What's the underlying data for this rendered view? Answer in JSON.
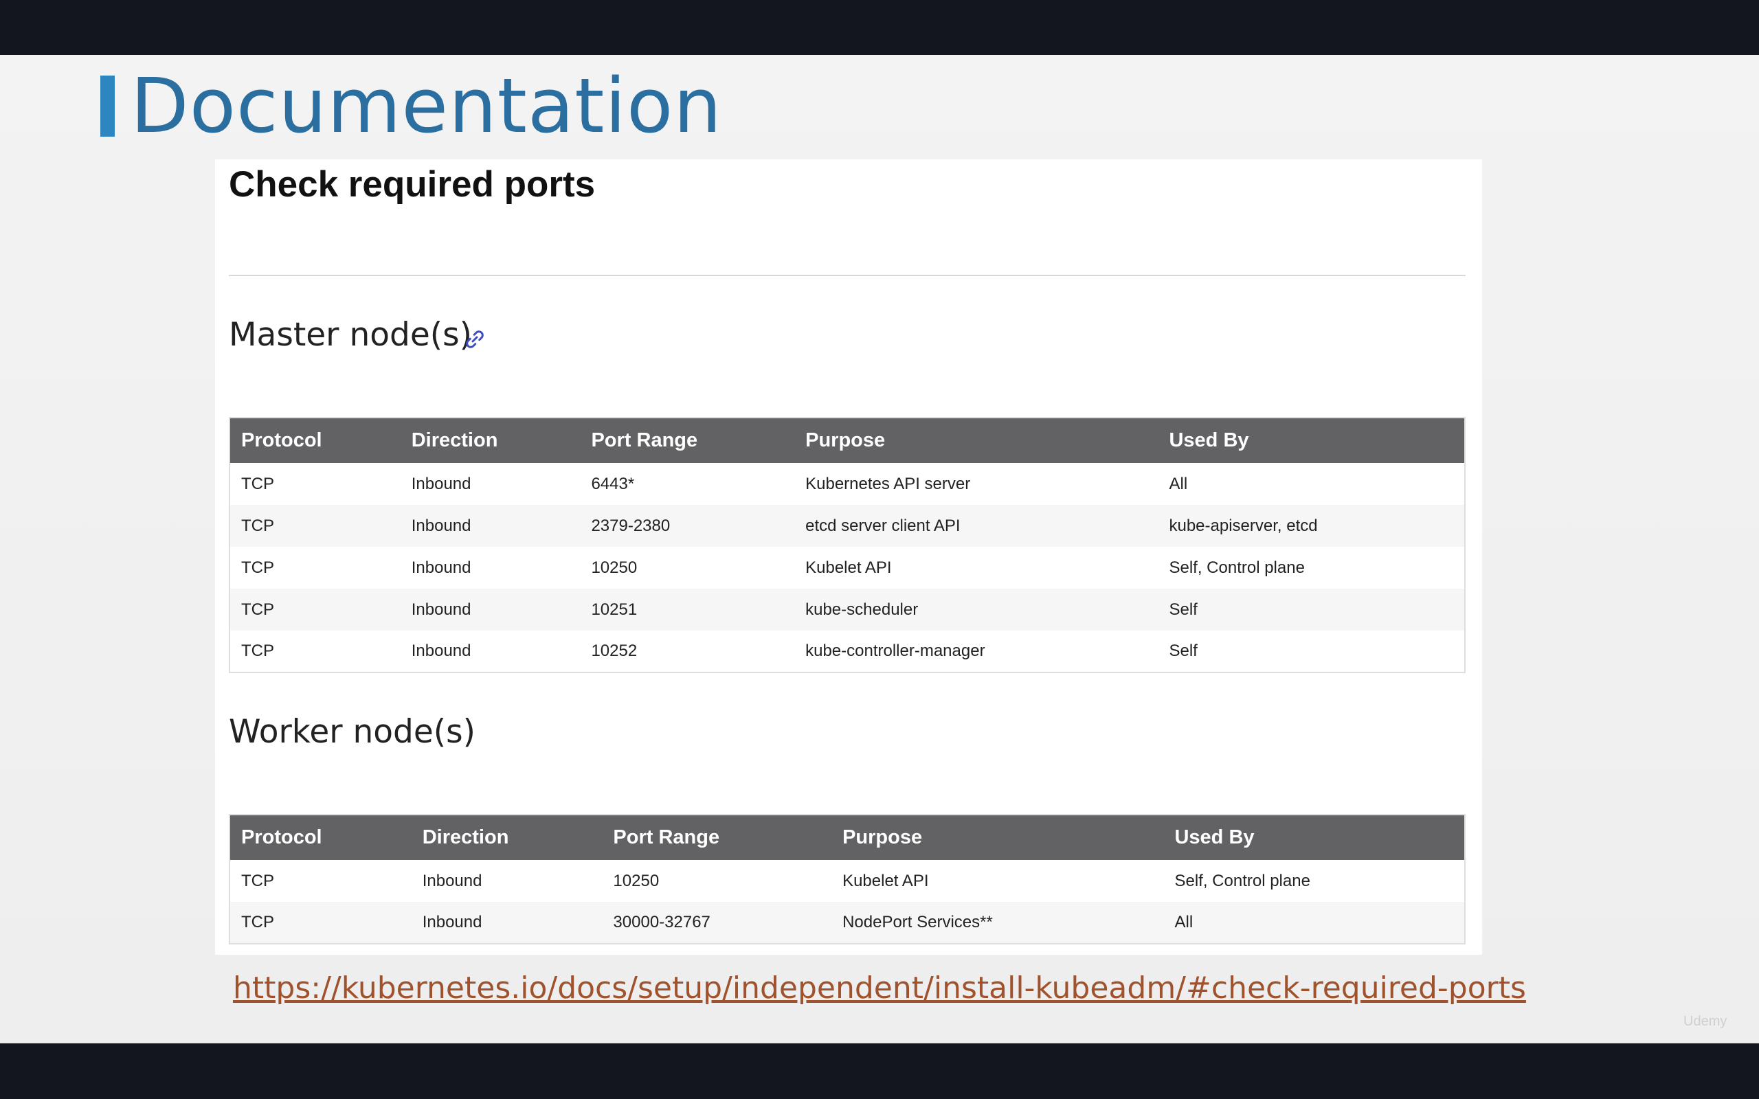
{
  "slide": {
    "title": "Documentation",
    "url": "https://kubernetes.io/docs/setup/independent/install-kubeadm/#check-required-ports",
    "watermark": "Udemy"
  },
  "doc": {
    "heading": "Check required ports",
    "master": {
      "title": "Master node(s)",
      "headers": [
        "Protocol",
        "Direction",
        "Port Range",
        "Purpose",
        "Used By"
      ],
      "rows": [
        [
          "TCP",
          "Inbound",
          "6443*",
          "Kubernetes API server",
          "All"
        ],
        [
          "TCP",
          "Inbound",
          "2379-2380",
          "etcd server client API",
          "kube-apiserver, etcd"
        ],
        [
          "TCP",
          "Inbound",
          "10250",
          "Kubelet API",
          "Self, Control plane"
        ],
        [
          "TCP",
          "Inbound",
          "10251",
          "kube-scheduler",
          "Self"
        ],
        [
          "TCP",
          "Inbound",
          "10252",
          "kube-controller-manager",
          "Self"
        ]
      ]
    },
    "worker": {
      "title": "Worker node(s)",
      "headers": [
        "Protocol",
        "Direction",
        "Port Range",
        "Purpose",
        "Used By"
      ],
      "rows": [
        [
          "TCP",
          "Inbound",
          "10250",
          "Kubelet API",
          "Self, Control plane"
        ],
        [
          "TCP",
          "Inbound",
          "30000-32767",
          "NodePort Services**",
          "All"
        ]
      ]
    }
  },
  "colors": {
    "title": "#2b6ea0",
    "accent": "#2e86c1",
    "table_header": "#626163",
    "link": "#a0522d",
    "anchor_icon": "#3b4cc0"
  },
  "icons": {
    "anchor": "link-icon"
  }
}
